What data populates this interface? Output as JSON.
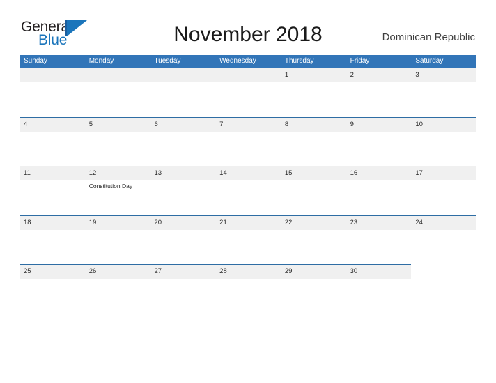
{
  "brand": {
    "name_top": "General",
    "name_bottom": "Blue",
    "top_color": "#231f20",
    "bottom_color": "#1b75bb",
    "flag_color": "#1b75bb"
  },
  "header": {
    "title": "November 2018",
    "region": "Dominican Republic"
  },
  "theme": {
    "header_bar_color": "#3275b8",
    "row_line_color": "#2e6da4",
    "date_band_color": "#f0f0f0",
    "page_background": "#ffffff"
  },
  "calendar": {
    "weekdays": [
      "Sunday",
      "Monday",
      "Tuesday",
      "Wednesday",
      "Thursday",
      "Friday",
      "Saturday"
    ],
    "weeks": [
      {
        "strip_span": 7,
        "days": [
          {
            "num": ""
          },
          {
            "num": ""
          },
          {
            "num": ""
          },
          {
            "num": ""
          },
          {
            "num": "1"
          },
          {
            "num": "2"
          },
          {
            "num": "3"
          }
        ]
      },
      {
        "strip_span": 7,
        "days": [
          {
            "num": "4"
          },
          {
            "num": "5"
          },
          {
            "num": "6"
          },
          {
            "num": "7"
          },
          {
            "num": "8"
          },
          {
            "num": "9"
          },
          {
            "num": "10"
          }
        ]
      },
      {
        "strip_span": 7,
        "days": [
          {
            "num": "11"
          },
          {
            "num": "12",
            "event": "Constitution Day"
          },
          {
            "num": "13"
          },
          {
            "num": "14"
          },
          {
            "num": "15"
          },
          {
            "num": "16"
          },
          {
            "num": "17"
          }
        ]
      },
      {
        "strip_span": 7,
        "days": [
          {
            "num": "18"
          },
          {
            "num": "19"
          },
          {
            "num": "20"
          },
          {
            "num": "21"
          },
          {
            "num": "22"
          },
          {
            "num": "23"
          },
          {
            "num": "24"
          }
        ]
      },
      {
        "strip_span": 6,
        "days": [
          {
            "num": "25"
          },
          {
            "num": "26"
          },
          {
            "num": "27"
          },
          {
            "num": "28"
          },
          {
            "num": "29"
          },
          {
            "num": "30"
          },
          {
            "num": ""
          }
        ]
      }
    ]
  }
}
